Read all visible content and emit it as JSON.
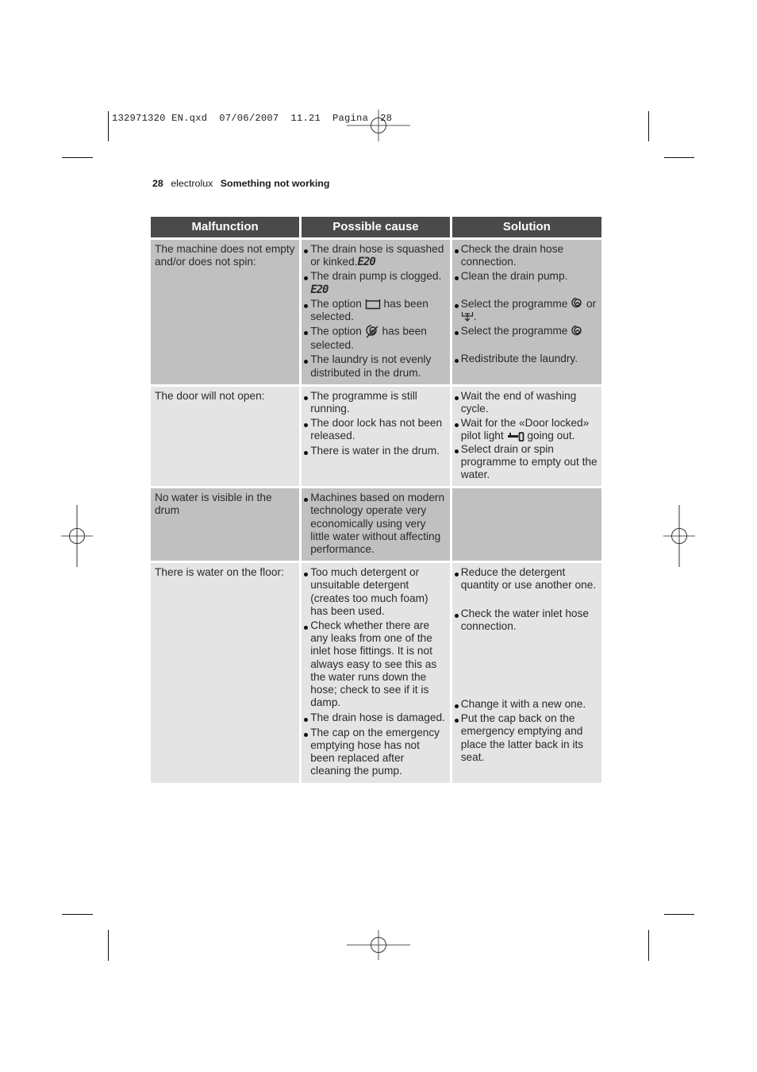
{
  "slug": "132971320 EN.qxd  07/06/2007  11.21  Pagina  28",
  "page_header": {
    "page_number": "28",
    "brand": "electrolux",
    "section_title": "Something not working"
  },
  "table": {
    "headers": [
      "Malfunction",
      "Possible cause",
      "Solution"
    ],
    "rows": [
      {
        "shade": "dark",
        "malfunction": "The machine does not empty and/or does not spin:",
        "causes": [
          {
            "text": "The drain hose is squashed or kinked.",
            "code": "E20"
          },
          {
            "text": "The drain pump is clogged.",
            "code": "E20"
          },
          {
            "pre": "The option",
            "icon": "rinse-hold-icon",
            "post": "has been selected."
          },
          {
            "pre": "The option",
            "icon": "no-spin-icon",
            "post": "has been selected."
          },
          {
            "text": "The laundry is not evenly distributed in the drum."
          }
        ],
        "solutions": [
          {
            "text": "Check the drain hose connection."
          },
          {
            "text": "Clean the drain pump."
          },
          {
            "pre": "Select the programme",
            "icon": "spin-icon",
            "mid": "or",
            "icon2": "drain-icon",
            "post": "."
          },
          {
            "pre": "Select the programme",
            "icon": "spin-icon"
          },
          {
            "text": "Redistribute the laundry."
          }
        ]
      },
      {
        "shade": "light",
        "malfunction": "The door will not open:",
        "causes": [
          {
            "text": "The programme is still running."
          },
          {
            "text": "The door lock has not been released."
          },
          {
            "text": "There is water in the drum."
          }
        ],
        "solutions": [
          {
            "text": "Wait the end of washing cycle."
          },
          {
            "pre": "Wait for the «Door locked» pilot light",
            "icon": "door-locked-key-icon",
            "post": "going out."
          },
          {
            "text": "Select drain or spin programme to empty out the water."
          }
        ]
      },
      {
        "shade": "dark",
        "malfunction": "No water is visible in the drum",
        "causes": [
          {
            "text": "Machines based on modern technology operate very economically using very little water without affecting performance."
          }
        ],
        "solutions": []
      },
      {
        "shade": "light",
        "malfunction": "There is water on the floor:",
        "causes": [
          {
            "text": "Too much detergent or unsuitable detergent (creates too much foam) has been used."
          },
          {
            "text": "Check whether there are any leaks from one of the inlet hose fittings. It is not always easy to see this as the water runs down the hose; check to see if it is damp."
          },
          {
            "text": "The drain hose is damaged."
          },
          {
            "text": "The cap on the emergency emptying hose has not been replaced after cleaning the pump."
          }
        ],
        "solutions": [
          {
            "text": "Reduce the detergent quantity or use another one."
          },
          {
            "text": "Check the water inlet hose connection."
          },
          {
            "text": "Change it with a new one."
          },
          {
            "text": "Put the cap back on the emergency emptying and place the latter back in its seat."
          }
        ]
      }
    ]
  }
}
